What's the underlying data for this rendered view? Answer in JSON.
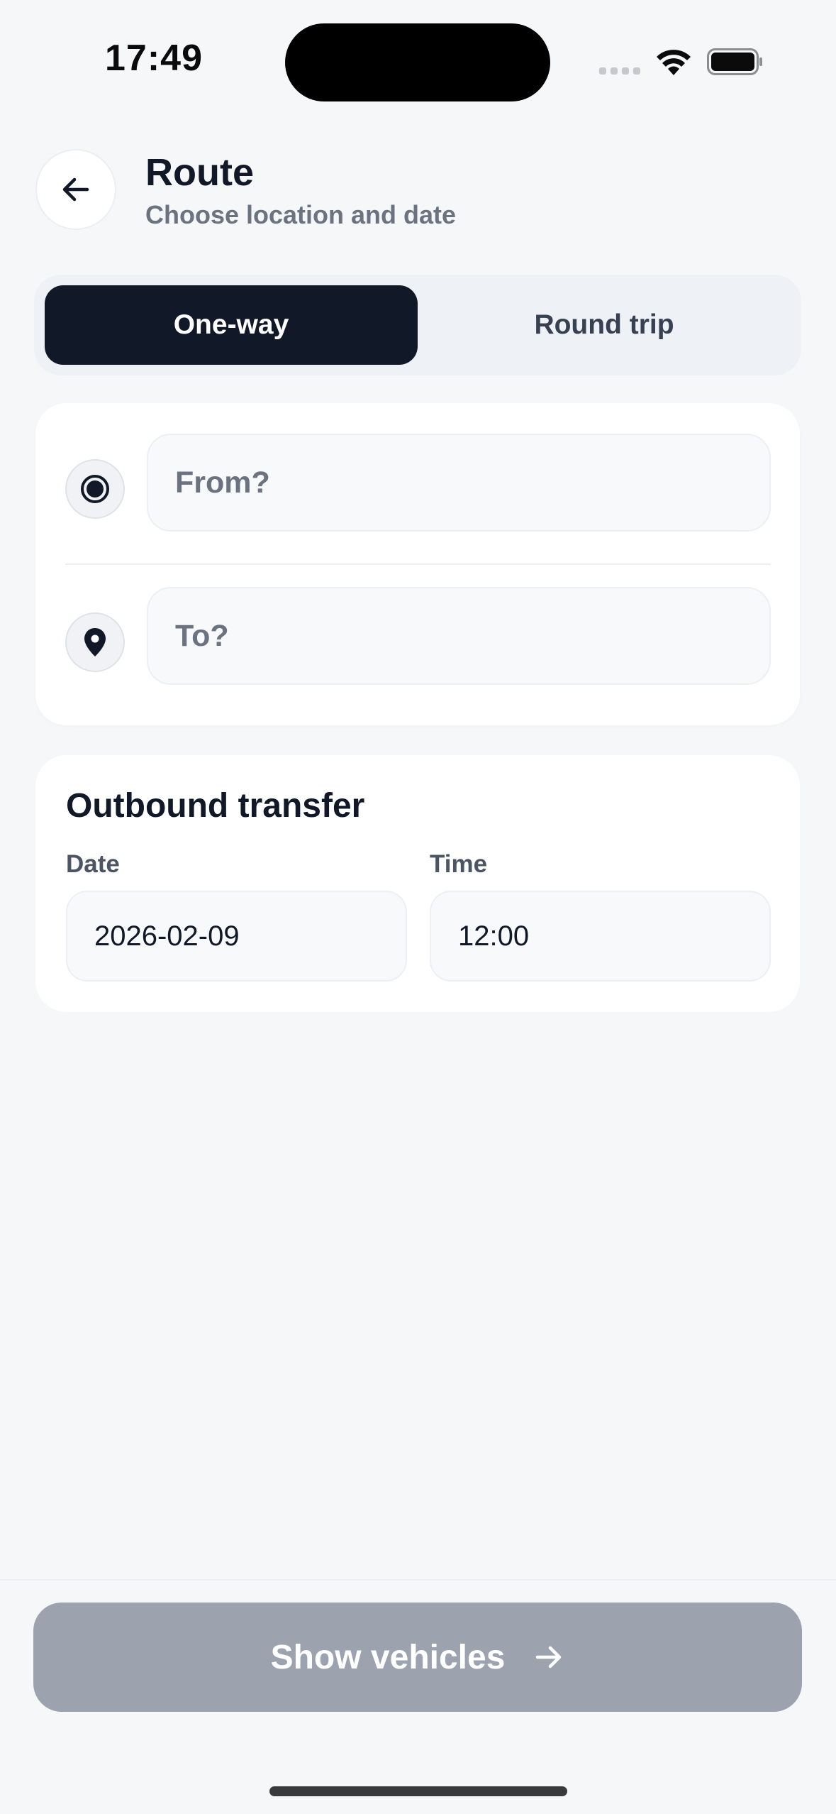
{
  "status_bar": {
    "time": "17:49"
  },
  "header": {
    "title": "Route",
    "subtitle": "Choose location and date"
  },
  "trip_type": {
    "options": [
      "One-way",
      "Round trip"
    ],
    "selected": "One-way"
  },
  "route": {
    "from_placeholder": "From?",
    "to_placeholder": "To?",
    "from_value": "",
    "to_value": ""
  },
  "outbound": {
    "title": "Outbound transfer",
    "date_label": "Date",
    "date_value": "2026-02-09",
    "time_label": "Time",
    "time_value": "12:00"
  },
  "cta": {
    "label": "Show vehicles",
    "enabled": false
  },
  "colors": {
    "background": "#f6f7f9",
    "primary_dark": "#111827",
    "muted_text": "#6b7280",
    "disabled_button": "#9ca3af"
  },
  "icons": {
    "back": "arrow-left-icon",
    "from": "radio-dot-icon",
    "to": "map-pin-icon",
    "cta": "arrow-right-icon"
  }
}
